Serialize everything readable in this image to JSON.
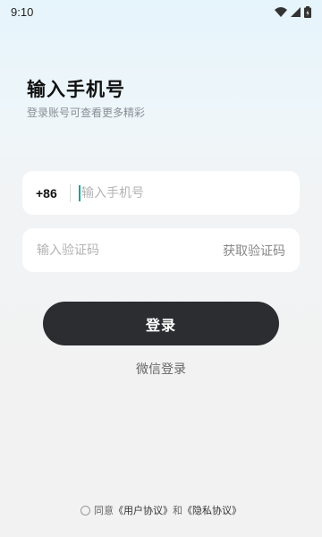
{
  "status_bar": {
    "time": "9:10",
    "icons": [
      "wifi-icon",
      "signal-icon",
      "battery-icon"
    ]
  },
  "header": {
    "title": "输入手机号",
    "subtitle": "登录账号可查看更多精彩"
  },
  "phone_field": {
    "country_code": "+86",
    "placeholder": "输入手机号",
    "value": ""
  },
  "code_field": {
    "placeholder": "输入验证码",
    "value": "",
    "get_code_label": "获取验证码"
  },
  "login_button_label": "登录",
  "wechat_login_label": "微信登录",
  "agreement": {
    "checked": false,
    "prefix": "同意",
    "user_agreement": "《用户协议》",
    "conjunction": "和",
    "privacy_policy": "《隐私协议》"
  },
  "colors": {
    "button_bg": "#2b2d31",
    "caret": "#1aa39a",
    "field_bg": "#ffffff"
  }
}
